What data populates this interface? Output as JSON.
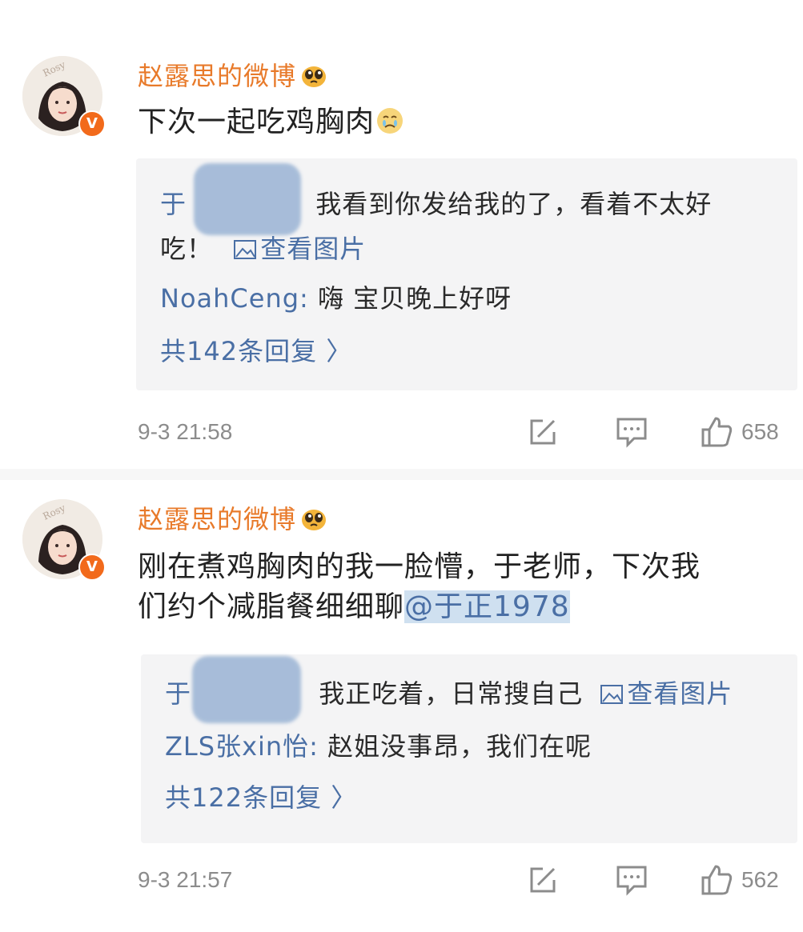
{
  "comments": [
    {
      "username": "赵露思的微博",
      "avatar_watermark": "Rosy",
      "vip_badge": "V",
      "text": "下次一起吃鸡胸肉",
      "replies": [
        {
          "author_prefix": "于",
          "text": "我看到你发给我的了，看着不太好",
          "text_cont": "吃！",
          "view_pic": "查看图片"
        },
        {
          "author": "NoahCeng:",
          "text": "嗨  宝贝晚上好呀"
        }
      ],
      "reply_count": "共142条回复 〉",
      "time": "9-3 21:58",
      "likes": "658"
    },
    {
      "username": "赵露思的微博",
      "avatar_watermark": "Rosy",
      "vip_badge": "V",
      "text_line1": "刚在煮鸡胸肉的我一脸懵，于老师，下次我",
      "text_line2": "们约个减脂餐细细聊",
      "mention": "@于正1978",
      "replies": [
        {
          "author_prefix": "于",
          "text": "我正吃着，日常搜自己",
          "view_pic": "查看图片"
        },
        {
          "author": "ZLS张xin怡:",
          "text": "赵姐没事昂，我们在呢"
        }
      ],
      "reply_count": "共122条回复 〉",
      "time": "9-3 21:57",
      "likes": "562"
    }
  ],
  "icons": {
    "share": "share-icon",
    "comment": "comment-icon",
    "like": "thumbs-up-icon",
    "picture": "picture-icon",
    "user_emoji": "emoji-icon"
  },
  "colors": {
    "username": "#e87a2a",
    "link": "#4a6fa5",
    "mention_bg": "#cfe0f0",
    "reply_bg": "#f4f4f5",
    "meta": "#8c8c8c",
    "vip": "#f26a1b"
  }
}
